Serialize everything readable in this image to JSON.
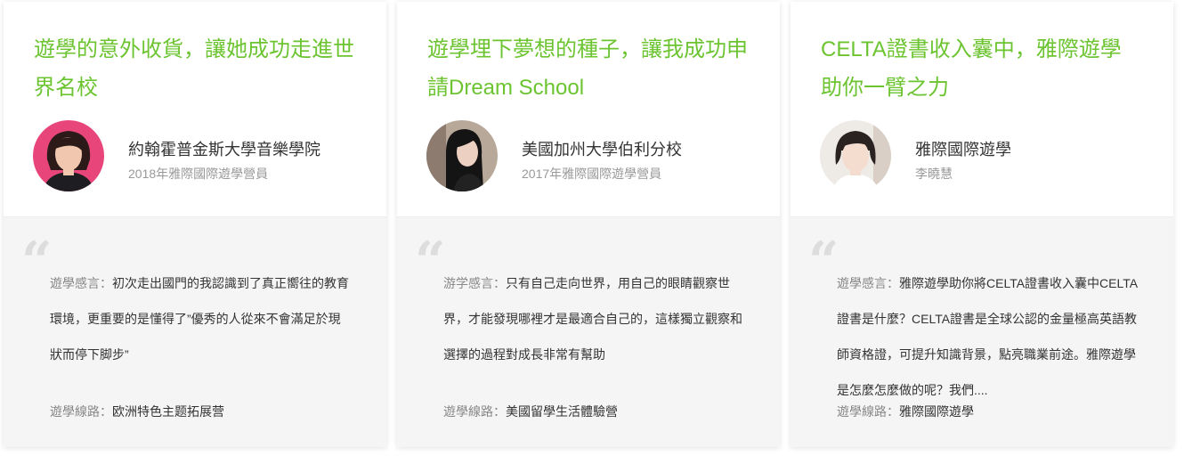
{
  "cards": [
    {
      "title": "遊學的意外收貨，讓她成功走進世界名校",
      "name": "約翰霍普金斯大學音樂學院",
      "subtitle": "2018年雅際國際遊學營員",
      "quote_label": "遊學感言：",
      "quote_text": "初次走出國門的我認識到了真正嚮往的教育環境，更重要的是懂得了”優秀的人從來不會滿足於現狀而停下脚步”",
      "route_label": "遊學線路：",
      "route_value": "欧洲特色主题拓展营"
    },
    {
      "title": "遊學埋下夢想的種子，讓我成功申請Dream School",
      "name": "美國加州大學伯利分校",
      "subtitle": "2017年雅際國際遊學營員",
      "quote_label": "游学感言：",
      "quote_text": "只有自己走向世界，用自己的眼睛觀察世界，才能發現哪裡才是最適合自己的，這樣獨立觀察和選擇的過程對成長非常有幫助",
      "route_label": "遊學線路：",
      "route_value": "美國留學生活體驗營"
    },
    {
      "title": "CELTA證書收入囊中，雅際遊學助你一臂之力",
      "name": "雅際國際遊學",
      "subtitle": "李曉慧",
      "quote_label": "遊學感言：",
      "quote_text": "雅際遊學助你將CELTA證書收入囊中CELTA證書是什麼？CELTA證書是全球公認的金量極高英語教師資格證，可提升知識背景，點亮職業前途。雅際遊學是怎麼怎麼做的呢？我們....",
      "route_label": "遊學線路：",
      "route_value": "雅際國際遊學"
    }
  ],
  "quote_mark": "“",
  "colors": {
    "title_green": "#6cc431",
    "label_gray": "#888888",
    "text_dark": "#333333",
    "card_bottom_bg": "#f5f5f5"
  }
}
